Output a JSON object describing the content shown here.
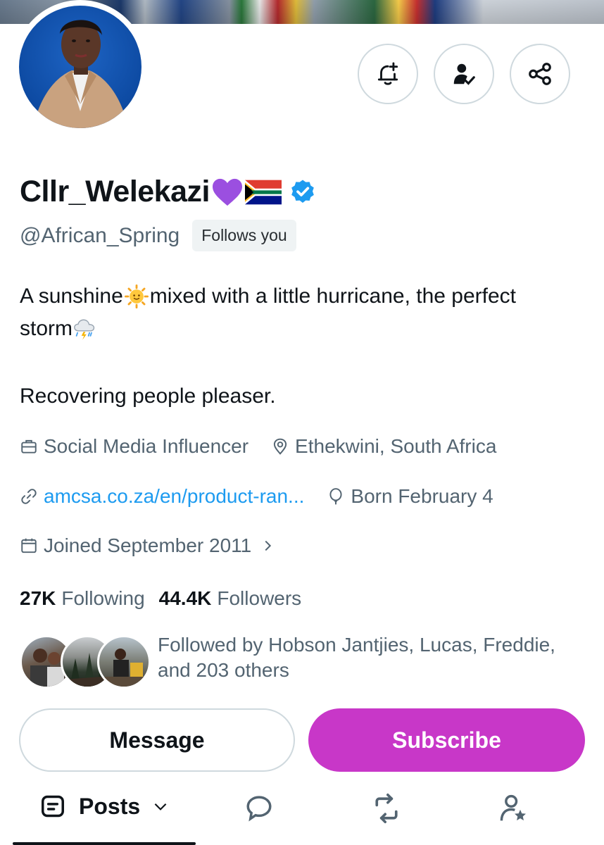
{
  "profile": {
    "display_name": "Cllr_Welekazi",
    "handle": "@African_Spring",
    "follows_you_badge": "Follows you",
    "verified": true
  },
  "bio": {
    "line1_a": "A sunshine ",
    "line1_b": "mixed with a little hurricane, the perfect",
    "line2": "storm",
    "line3": "Recovering people pleaser."
  },
  "meta": {
    "category": "Social Media Influencer",
    "location": "Ethekwini, South Africa",
    "website": "amcsa.co.za/en/product-ran...",
    "birthday": "Born February 4",
    "joined": "Joined September 2011"
  },
  "stats": {
    "following_count": "27K",
    "following_label": "Following",
    "followers_count": "44.4K",
    "followers_label": "Followers"
  },
  "followed_by": {
    "line1": "Followed by Hobson Jantjies, Lucas, Freddie,",
    "line2": "and 203 others"
  },
  "buttons": {
    "message": "Message",
    "subscribe": "Subscribe"
  },
  "tabs": {
    "posts_label": "Posts"
  },
  "colors": {
    "accent_blue": "#1d9bf0",
    "subscribe_purple": "#c837c8",
    "text_secondary": "#536471"
  },
  "icons": [
    "bell-plus-icon",
    "person-check-icon",
    "share-icon",
    "briefcase-icon",
    "location-pin-icon",
    "link-icon",
    "balloon-icon",
    "calendar-icon",
    "chevron-right-icon",
    "posts-icon",
    "chevron-down-icon",
    "reply-icon",
    "repost-icon",
    "person-star-icon",
    "verified-badge-icon"
  ]
}
